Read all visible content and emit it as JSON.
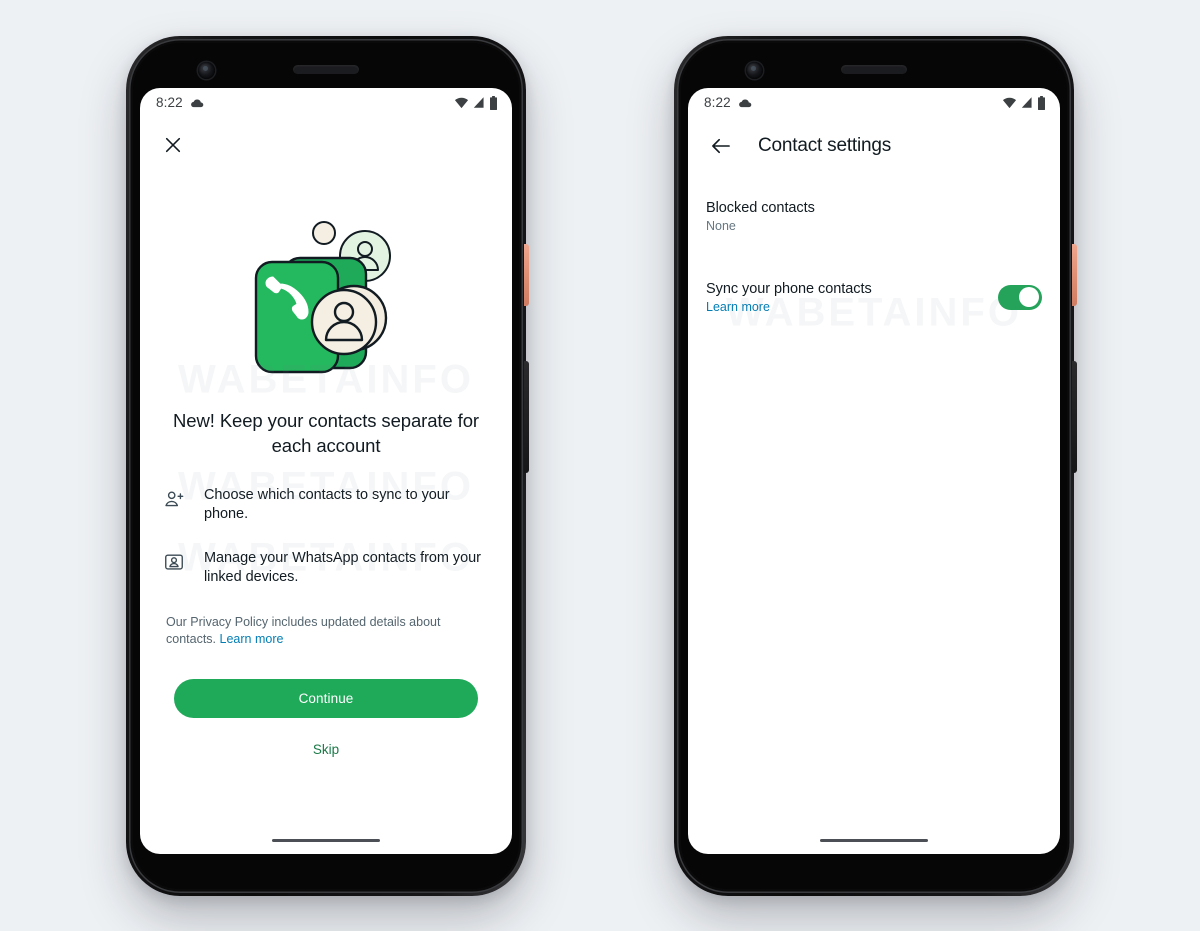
{
  "page": {
    "background_color": "#eef1f4",
    "watermark_text": "WABETAINFO"
  },
  "colors": {
    "brand_green": "#1faa5a",
    "toggle_green": "#25a35b",
    "link_blue": "#027eb5",
    "skip_green": "#1b7a48",
    "text_primary": "#111b21",
    "text_secondary": "#667781",
    "power_button": "#e08f74"
  },
  "phones": [
    {
      "id": "onboarding",
      "status_bar": {
        "time": "8:22",
        "cloud_icon": "cloud-icon",
        "wifi_icon": "wifi-icon",
        "signal_icon": "signal-icon",
        "battery_icon": "battery-icon"
      },
      "close_icon": "close-icon",
      "illustration": {
        "name": "contacts-card-illustration",
        "phone_card_color": "#1faa5a",
        "avatar_green_color": "#e0f2e0",
        "avatar_cream_color": "#f3ece0"
      },
      "headline": "New! Keep your contacts separate for each account",
      "features": [
        {
          "icon": "person-add-icon",
          "text": "Choose which contacts to sync to your phone."
        },
        {
          "icon": "contact-card-icon",
          "text": "Manage your WhatsApp contacts from your linked devices."
        }
      ],
      "policy": {
        "text": "Our Privacy Policy includes updated details about contacts.",
        "link_label": "Learn more"
      },
      "primary_button": "Continue",
      "secondary_button": "Skip"
    },
    {
      "id": "contact-settings",
      "status_bar": {
        "time": "8:22",
        "cloud_icon": "cloud-icon",
        "wifi_icon": "wifi-icon",
        "signal_icon": "signal-icon",
        "battery_icon": "battery-icon"
      },
      "back_icon": "back-arrow-icon",
      "title": "Contact settings",
      "rows": [
        {
          "title": "Blocked contacts",
          "subtitle": "None",
          "has_toggle": false
        },
        {
          "title": "Sync your phone contacts",
          "link_label": "Learn more",
          "has_toggle": true,
          "toggle_state": "on"
        }
      ]
    }
  ]
}
